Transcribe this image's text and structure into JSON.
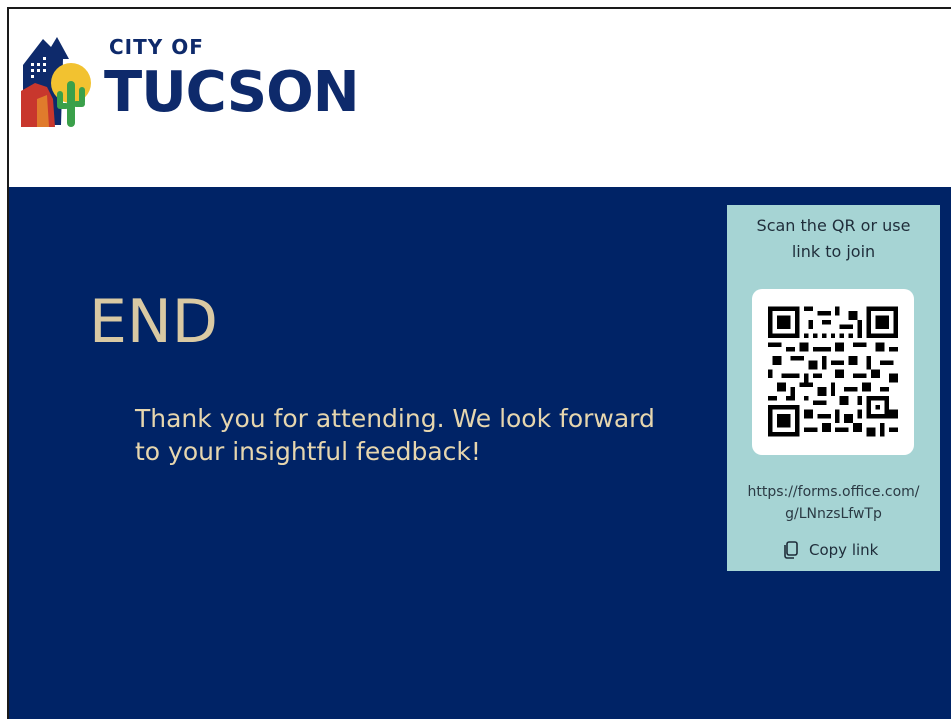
{
  "header": {
    "logo": {
      "line1": "CITY OF",
      "line2": "TUCSON"
    }
  },
  "slide": {
    "title": "END",
    "message": "Thank you for attending. We look forward to your insightful feedback!"
  },
  "qr_panel": {
    "heading": "Scan the QR or use link to join",
    "link": "https://forms.office.com/g/LNnzsLfwTp",
    "copy_label": "Copy link",
    "icons": {
      "copy": "copy-icon",
      "qr": "qr-code-icon"
    },
    "colors": {
      "panel_bg": "#a6d4d4",
      "slide_bg": "#002366",
      "title_color": "#d9c9a3",
      "logo_navy": "#0e2a6b"
    }
  }
}
